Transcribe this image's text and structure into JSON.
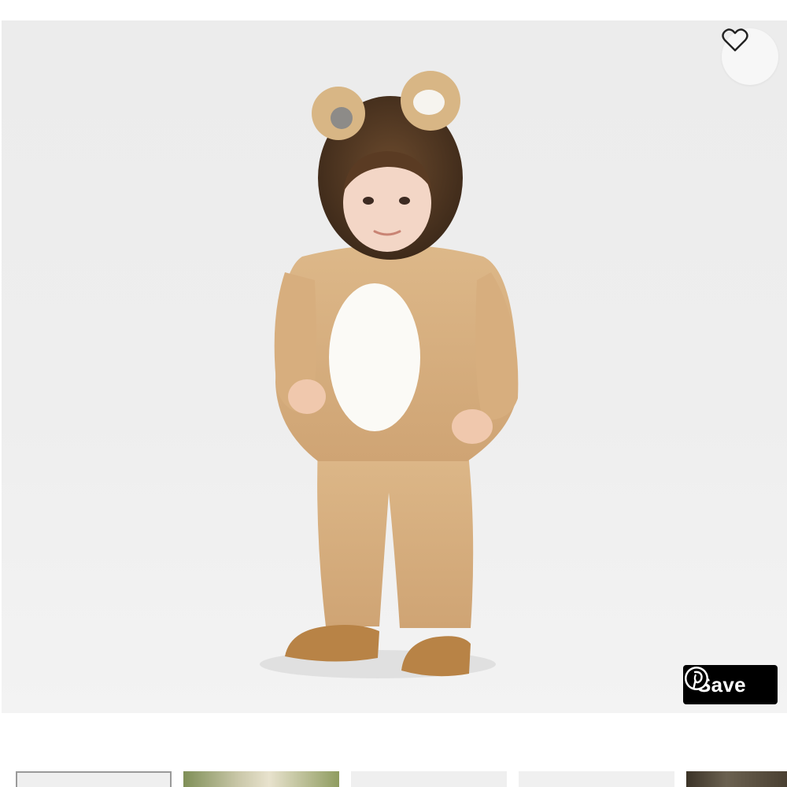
{
  "product_image": {
    "alt": ""
  },
  "actions": {
    "favorite_icon": "heart-outline-icon",
    "save_label": "Save",
    "save_icon": "pinterest-icon"
  },
  "thumbnails": [
    {
      "selected": true
    },
    {
      "selected": false
    },
    {
      "selected": false
    },
    {
      "selected": false
    },
    {
      "selected": false
    }
  ]
}
